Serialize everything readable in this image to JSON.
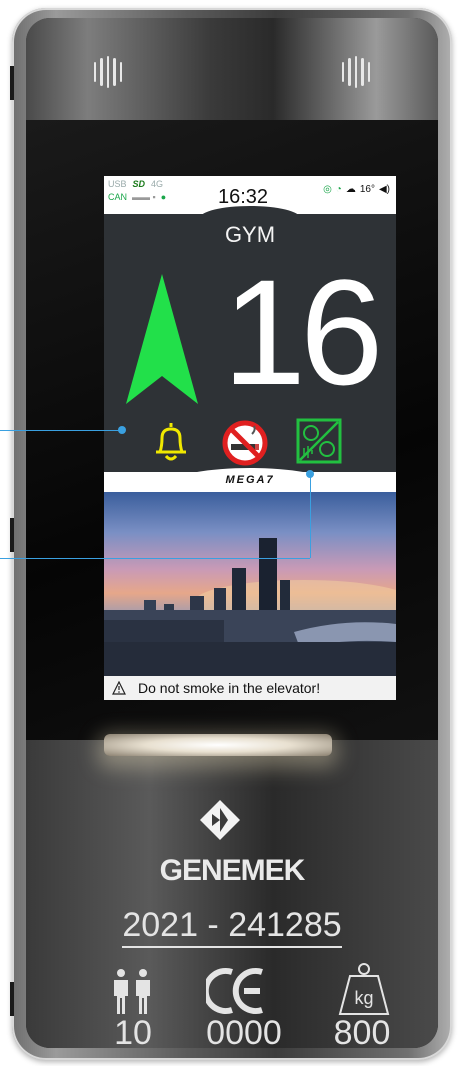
{
  "status_bar": {
    "usb": "USB",
    "sd": "SD",
    "network": "4G",
    "can": "CAN",
    "time": "16:32",
    "temperature": "16°"
  },
  "display": {
    "location_label": "GYM",
    "floor_number": "16",
    "direction": "up",
    "arrow_color": "#22e04a",
    "brand": "MEGA7",
    "message": "Do not smoke in the elevator!"
  },
  "icons": {
    "alarm": "bell-icon",
    "no_smoking": "no-smoking-icon",
    "voice": "voice-communication-icon"
  },
  "plate": {
    "brand_name": "GENEMEK",
    "registration": "2021 - 241285",
    "persons": "10",
    "ce_number": "0000",
    "capacity": "800",
    "capacity_unit": "kg"
  },
  "colors": {
    "bell": "#f0e800",
    "no_smoking_red": "#e02020",
    "voice_green": "#22c040",
    "callout_blue": "#3aa0e0"
  }
}
